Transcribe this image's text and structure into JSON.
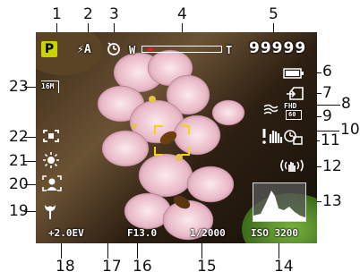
{
  "callouts": [
    "1",
    "2",
    "3",
    "4",
    "5",
    "6",
    "7",
    "8",
    "9",
    "10",
    "11",
    "12",
    "13",
    "14",
    "15",
    "16",
    "17",
    "18",
    "19",
    "20",
    "21",
    "22",
    "23"
  ],
  "osd": {
    "mode": "P",
    "flash": "⚡A",
    "zoom_wide": "W",
    "zoom_tele": "T",
    "shots_remaining": "99999",
    "video_resolution": "FHD",
    "video_fps": "60",
    "histogram_label": "",
    "exposure_comp": "+2.0EV",
    "aperture": "F13.0",
    "shutter": "1/2000",
    "iso": "ISO 3200",
    "image_size": "16M",
    "zoom_level_fraction": 0.08
  },
  "colors": {
    "mode_bg": "#c8d400",
    "mode_fg": "#000000",
    "af_frame": "#f5d400",
    "zoom_marker": "#d81f26"
  },
  "icons": [
    "mode-p-icon",
    "flash-auto-icon",
    "self-timer-icon",
    "zoom-bar-icon",
    "battery-icon",
    "memory-card-icon",
    "wind-cut-icon",
    "video-resolution-icon",
    "hand-shake-warning-icon",
    "face-detect-icon",
    "stabilizer-icon",
    "histogram-icon",
    "af-frame-icon",
    "macro-icon",
    "face-beauty-icon",
    "white-balance-daylight-icon",
    "metering-icon",
    "image-size-icon"
  ]
}
